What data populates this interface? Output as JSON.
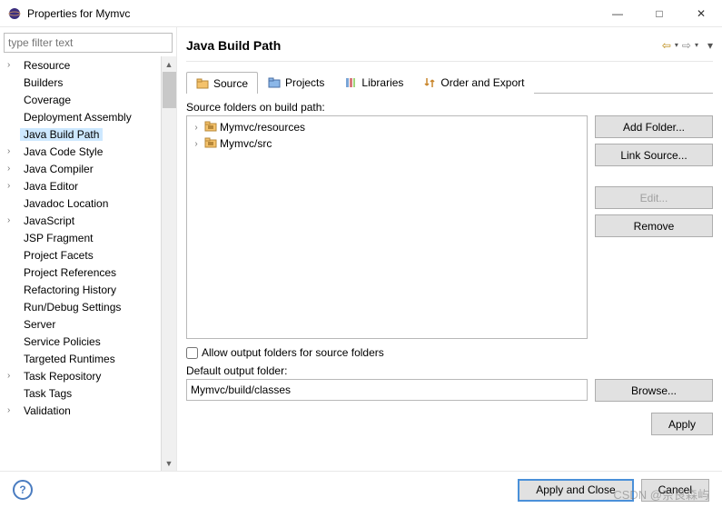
{
  "window": {
    "title": "Properties for Mymvc"
  },
  "filter": {
    "placeholder": "type filter text"
  },
  "sidebar": {
    "items": [
      {
        "label": "Resource",
        "expandable": true
      },
      {
        "label": "Builders",
        "expandable": false
      },
      {
        "label": "Coverage",
        "expandable": false
      },
      {
        "label": "Deployment Assembly",
        "expandable": false
      },
      {
        "label": "Java Build Path",
        "expandable": false,
        "selected": true
      },
      {
        "label": "Java Code Style",
        "expandable": true
      },
      {
        "label": "Java Compiler",
        "expandable": true
      },
      {
        "label": "Java Editor",
        "expandable": true
      },
      {
        "label": "Javadoc Location",
        "expandable": false
      },
      {
        "label": "JavaScript",
        "expandable": true
      },
      {
        "label": "JSP Fragment",
        "expandable": false
      },
      {
        "label": "Project Facets",
        "expandable": false
      },
      {
        "label": "Project References",
        "expandable": false
      },
      {
        "label": "Refactoring History",
        "expandable": false
      },
      {
        "label": "Run/Debug Settings",
        "expandable": false
      },
      {
        "label": "Server",
        "expandable": false
      },
      {
        "label": "Service Policies",
        "expandable": false
      },
      {
        "label": "Targeted Runtimes",
        "expandable": false
      },
      {
        "label": "Task Repository",
        "expandable": true
      },
      {
        "label": "Task Tags",
        "expandable": false
      },
      {
        "label": "Validation",
        "expandable": true
      }
    ]
  },
  "main": {
    "title": "Java Build Path",
    "tabs": [
      {
        "label": "Source",
        "icon": "source-folder-icon",
        "active": true
      },
      {
        "label": "Projects",
        "icon": "projects-icon",
        "active": false
      },
      {
        "label": "Libraries",
        "icon": "libraries-icon",
        "active": false
      },
      {
        "label": "Order and Export",
        "icon": "order-icon",
        "active": false
      }
    ],
    "source_label": "Source folders on build path:",
    "source_folders": [
      {
        "label": "Mymvc/resources"
      },
      {
        "label": "Mymvc/src"
      }
    ],
    "buttons": {
      "add_folder": "Add Folder...",
      "link_source": "Link Source...",
      "edit": "Edit...",
      "remove": "Remove",
      "browse": "Browse..."
    },
    "allow_output_label": "Allow output folders for source folders",
    "default_output_label": "Default output folder:",
    "default_output_value": "Mymvc/build/classes"
  },
  "footer": {
    "apply": "Apply",
    "apply_close": "Apply and Close",
    "cancel": "Cancel"
  },
  "watermark": "CSDN @奈良森屿"
}
